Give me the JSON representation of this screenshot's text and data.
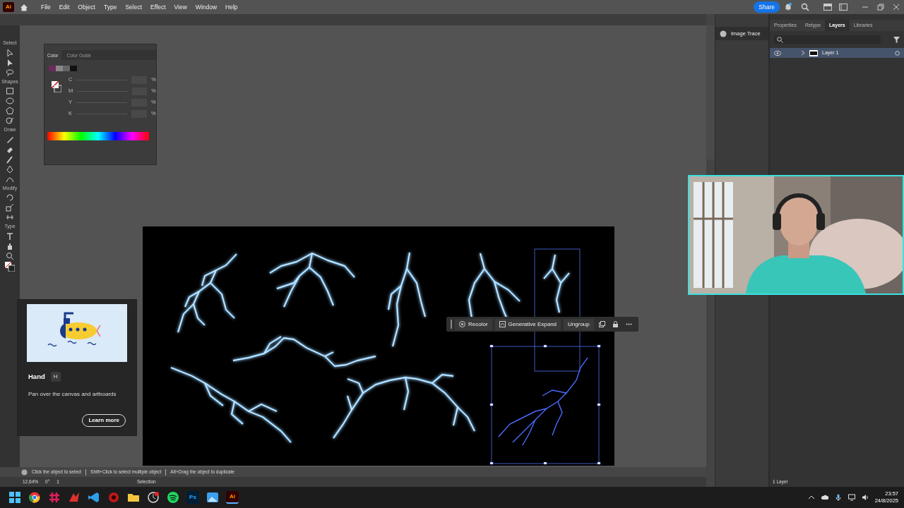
{
  "app_logo": "Ai",
  "menu": [
    "File",
    "Edit",
    "Object",
    "Type",
    "Select",
    "Effect",
    "View",
    "Window",
    "Help"
  ],
  "share": "Share",
  "toolbar_labels": [
    "Select",
    "Shapes",
    "Draw",
    "Modify",
    "Type"
  ],
  "color_panel": {
    "tabs": [
      {
        "label": "Color",
        "selected": true
      },
      {
        "label": "Color Guide",
        "selected": false
      }
    ],
    "channels": [
      {
        "name": "C",
        "unit": "%"
      },
      {
        "name": "M",
        "unit": "%"
      },
      {
        "name": "Y",
        "unit": "%"
      },
      {
        "name": "K",
        "unit": "%"
      }
    ]
  },
  "tooltip": {
    "title": "Hand",
    "shortcut": "H",
    "description": "Pan over the canvas and artboards",
    "button": "Learn more"
  },
  "context_bar": {
    "buttons": [
      "Recolor",
      "Generative Expand",
      "Ungroup"
    ]
  },
  "image_trace": "Image Trace",
  "panel_tabs": [
    {
      "label": "Properties",
      "selected": false
    },
    {
      "label": "Retype",
      "selected": false
    },
    {
      "label": "Layers",
      "selected": true
    },
    {
      "label": "Libraries",
      "selected": false
    }
  ],
  "layers": [
    {
      "name": "Layer 1",
      "visible": true,
      "selected": true
    }
  ],
  "status_hints": [
    "Click the object to select",
    "Shift+Click to select multiple object",
    "Alt+Drag the object to duplicate"
  ],
  "bottom_bar": {
    "zoom": "12,64%",
    "rotation": "0°",
    "artboard": "1",
    "tool": "Selection"
  },
  "layer_count": "1 Layer",
  "taskbar": {
    "apps": [
      {
        "kind": "start"
      },
      {
        "kind": "chrome"
      },
      {
        "kind": "slack"
      },
      {
        "kind": "red"
      },
      {
        "kind": "vscode"
      },
      {
        "kind": "record"
      },
      {
        "kind": "folder"
      },
      {
        "kind": "clock"
      },
      {
        "kind": "spotify"
      },
      {
        "kind": "ps",
        "label": "Ps"
      },
      {
        "kind": "photos"
      },
      {
        "kind": "ai",
        "label": "Ai",
        "selected": true
      }
    ],
    "time": "23:57",
    "date": "24/8/2025"
  },
  "webcam": {
    "kind": "picture"
  }
}
